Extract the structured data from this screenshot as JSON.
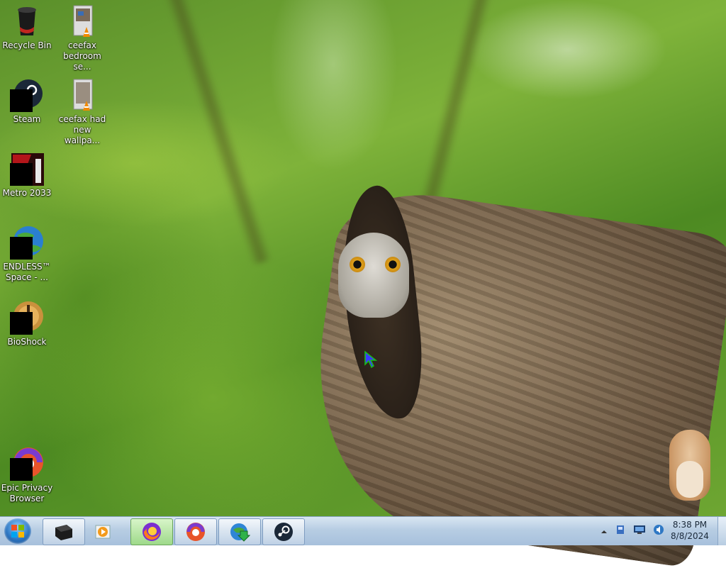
{
  "desktop": {
    "icons": [
      {
        "label": "Recycle Bin",
        "icon": "recycle-bin-icon"
      },
      {
        "label": "ceefax bedroom se...",
        "icon": "vlc-video-file-icon"
      },
      {
        "label": "Steam",
        "icon": "steam-icon"
      },
      {
        "label": "ceefax had new wallpa...",
        "icon": "vlc-video-file-icon"
      },
      {
        "label": "Metro 2033",
        "icon": "metro-2033-icon"
      },
      {
        "label": "ENDLESS™ Space - ...",
        "icon": "endless-space-icon"
      },
      {
        "label": "BioShock",
        "icon": "bioshock-icon"
      },
      {
        "label": "Epic Privacy Browser",
        "icon": "epic-browser-icon"
      }
    ]
  },
  "taskbar": {
    "pinned": [
      {
        "name": "Desktop folder",
        "icon": "desktop-folder-icon"
      },
      {
        "name": "Media player",
        "icon": "media-player-icon"
      },
      {
        "name": "Firefox",
        "icon": "firefox-icon"
      },
      {
        "name": "Epic Privacy Browser",
        "icon": "epic-browser-icon"
      },
      {
        "name": "Internet Download Manager",
        "icon": "download-manager-icon"
      },
      {
        "name": "Steam",
        "icon": "steam-icon"
      }
    ],
    "clock": {
      "time": "8:38 PM",
      "date": "8/8/2024"
    }
  },
  "colors": {
    "taskbar_top": "#d9e6f2",
    "taskbar_bottom": "#a7c0dc",
    "active_button": "#9ed98a",
    "wallpaper_green": "#6ea632"
  }
}
